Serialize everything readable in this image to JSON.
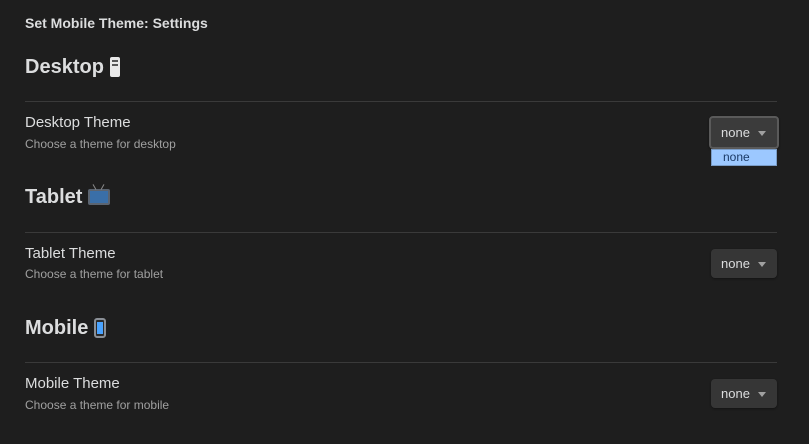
{
  "settings_header": {
    "title": "Set Mobile Theme: Settings"
  },
  "sections": [
    {
      "heading": "Desktop",
      "icon": "desktop-computer-icon",
      "setting_name": "Desktop Theme",
      "setting_desc": "Choose a theme for desktop",
      "selected": "none",
      "dropdown_open": true,
      "options": [
        "none"
      ]
    },
    {
      "heading": "Tablet",
      "icon": "television-icon",
      "setting_name": "Tablet Theme",
      "setting_desc": "Choose a theme for tablet",
      "selected": "none",
      "dropdown_open": false
    },
    {
      "heading": "Mobile",
      "icon": "mobile-phone-icon",
      "setting_name": "Mobile Theme",
      "setting_desc": "Choose a theme for mobile",
      "selected": "none",
      "dropdown_open": false
    }
  ],
  "colors": {
    "background": "#1e1e1e",
    "text": "#dcddde",
    "muted_text": "#a0a0a0",
    "divider": "#3a3a3a",
    "dropdown_bg": "#363636",
    "highlight_option": "#9cc8ff"
  }
}
